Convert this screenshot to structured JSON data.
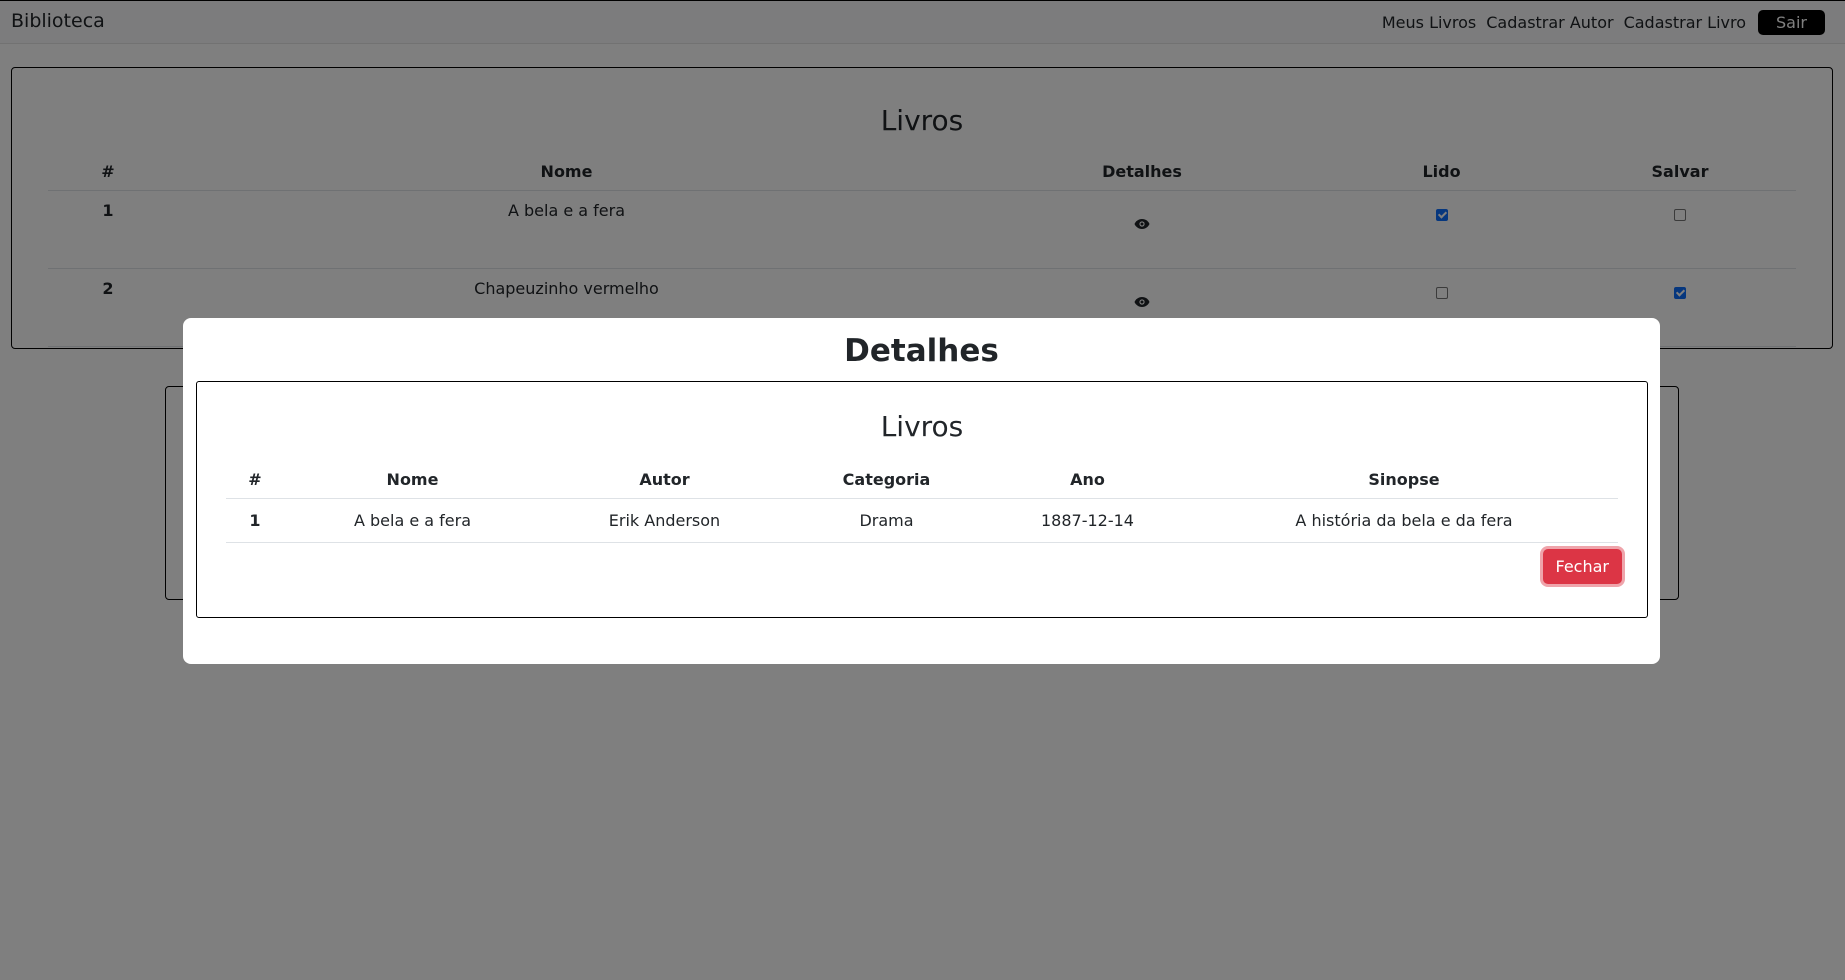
{
  "navbar": {
    "brand": "Biblioteca",
    "links": [
      "Meus Livros",
      "Cadastrar Autor",
      "Cadastrar Livro"
    ],
    "logout_label": "Sair"
  },
  "main": {
    "title": "Livros",
    "columns": [
      "#",
      "Nome",
      "Detalhes",
      "Lido",
      "Salvar"
    ],
    "rows": [
      {
        "num": "1",
        "nome": "A bela e a fera",
        "lido": true,
        "salvar": false
      },
      {
        "num": "2",
        "nome": "Chapeuzinho vermelho",
        "lido": false,
        "salvar": true
      }
    ]
  },
  "modal": {
    "title": "Detalhes",
    "card_title": "Livros",
    "columns": [
      "#",
      "Nome",
      "Autor",
      "Categoria",
      "Ano",
      "Sinopse"
    ],
    "row": {
      "num": "1",
      "nome": "A bela e a fera",
      "autor": "Erik Anderson",
      "categoria": "Drama",
      "ano": "1887-12-14",
      "sinopse": "A história da bela e da fera"
    },
    "close_label": "Fechar"
  },
  "colors": {
    "checkbox_checked": "#0d6efd",
    "close_button": "#dc3545",
    "logout_button": "#000000"
  }
}
